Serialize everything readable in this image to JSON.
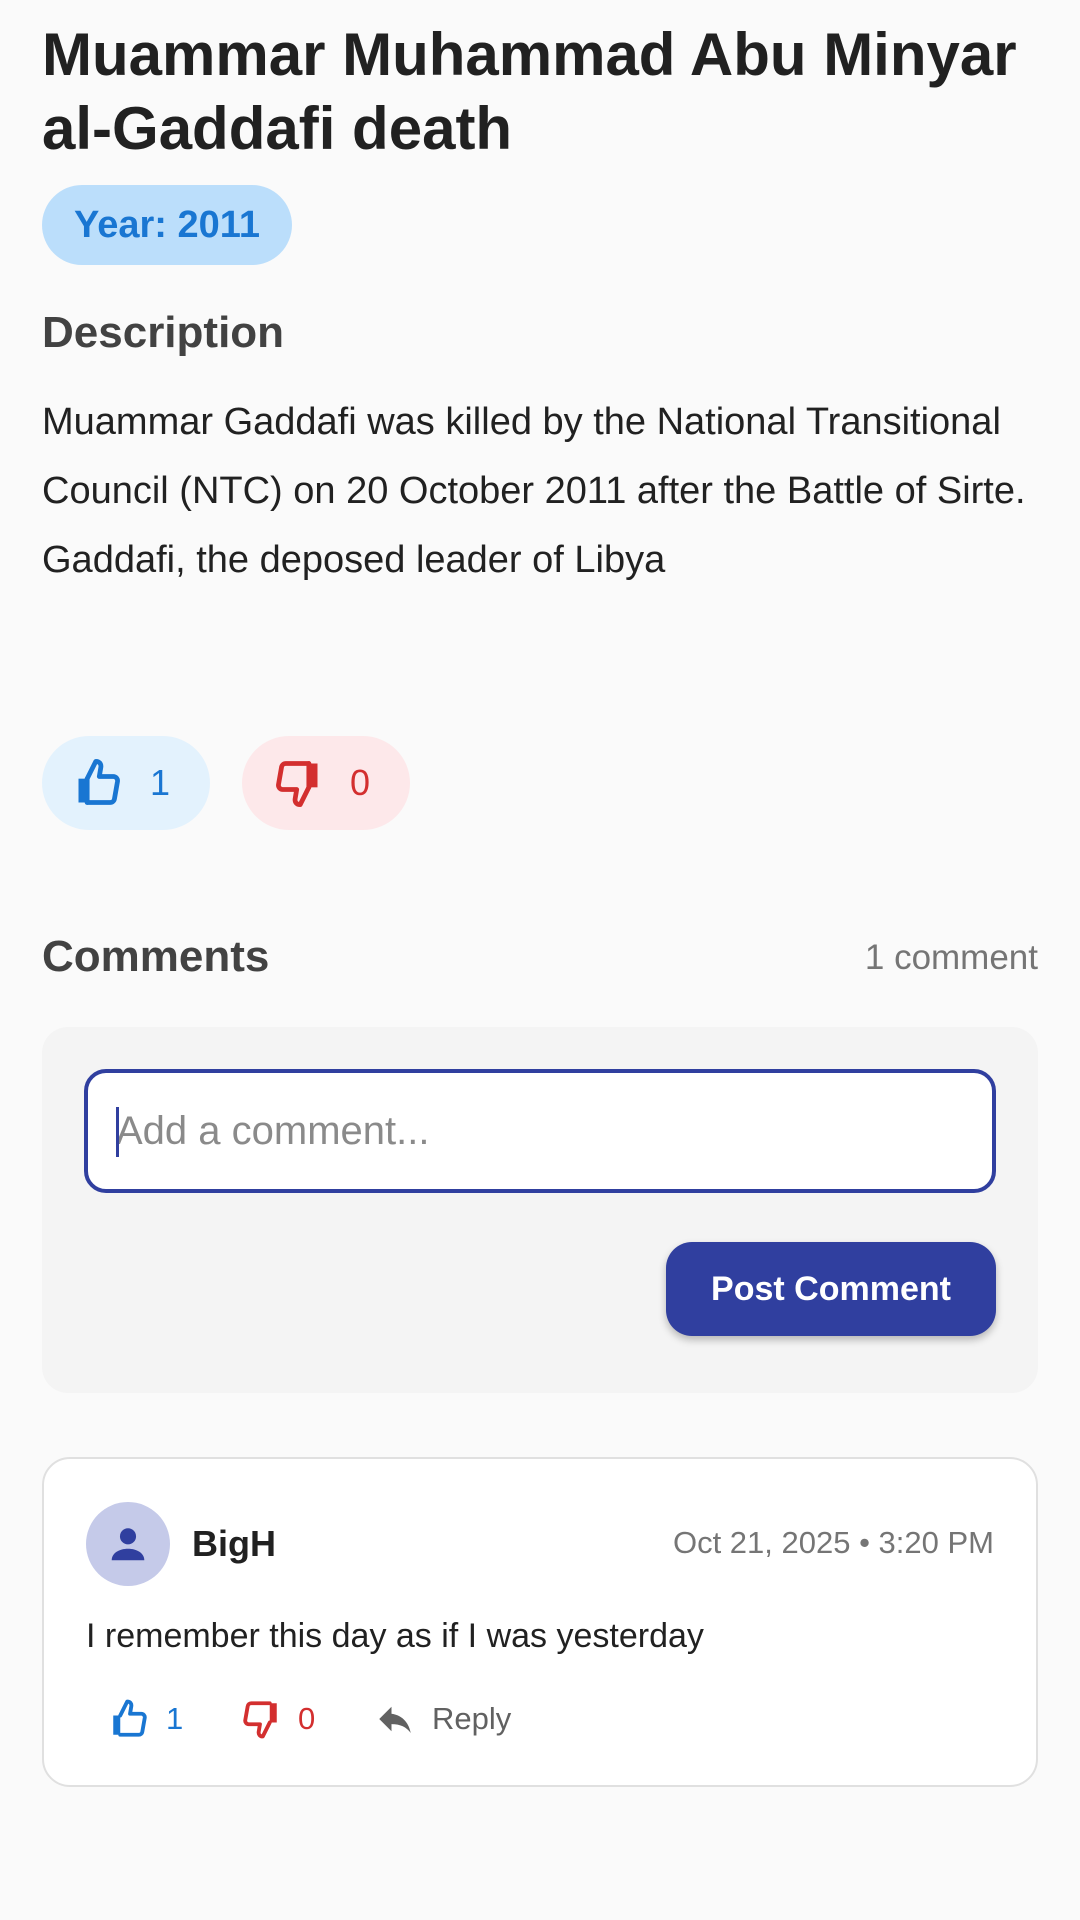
{
  "event": {
    "title": "Muammar Muhammad Abu Minyar al-Gaddafi death",
    "year_label": "Year: 2011",
    "description_heading": "Description",
    "description": "Muammar Gaddafi was killed by the National Transitional Council (NTC) on 20 October 2011 after the Battle of Sirte. Gaddafi, the deposed leader of Libya",
    "likes": "1",
    "dislikes": "0"
  },
  "comments": {
    "heading": "Comments",
    "count_label": "1 comment",
    "input_placeholder": "Add a comment...",
    "post_button_label": "Post Comment",
    "items": [
      {
        "author": "BigH",
        "timestamp": "Oct 21, 2025 • 3:20 PM",
        "text": "I remember this day as if I was yesterday",
        "likes": "1",
        "dislikes": "0",
        "reply_label": "Reply",
        "avatar_icon": "person-icon"
      }
    ]
  },
  "icons": {
    "like": "thumb-up-icon",
    "dislike": "thumb-down-icon",
    "reply": "reply-icon"
  },
  "colors": {
    "primary": "#303f9f",
    "like": "#1976d2",
    "dislike": "#d32f2f",
    "year_chip_bg": "#bbdefb"
  }
}
